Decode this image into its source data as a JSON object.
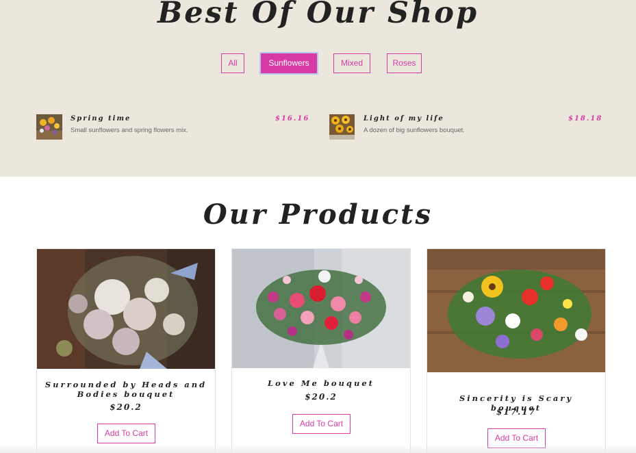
{
  "shop": {
    "title": "Best Of Our Shop",
    "filters": [
      "All",
      "Sunflowers",
      "Mixed",
      "Roses"
    ],
    "active_filter": "Sunflowers",
    "items": [
      {
        "name": "Spring time",
        "description": "Small sunflowers and spring flowers mix.",
        "price": "$16.16"
      },
      {
        "name": "Light of my life",
        "description": "A dozen of big sunflowers bouquet.",
        "price": "$18.18"
      }
    ]
  },
  "products": {
    "title": "Our Products",
    "items": [
      {
        "name": "Surrounded by Heads and Bodies bouquet",
        "price": "$20.2",
        "button": "Add To Cart"
      },
      {
        "name": "Love Me bouquet",
        "price": "$20.2",
        "button": "Add To Cart"
      },
      {
        "name": "Sincerity is Scary bouquet",
        "price": "$17.17",
        "button": "Add To Cart"
      }
    ]
  },
  "colors": {
    "accent": "#d63aa4",
    "shop_bg": "#ece7dc"
  }
}
